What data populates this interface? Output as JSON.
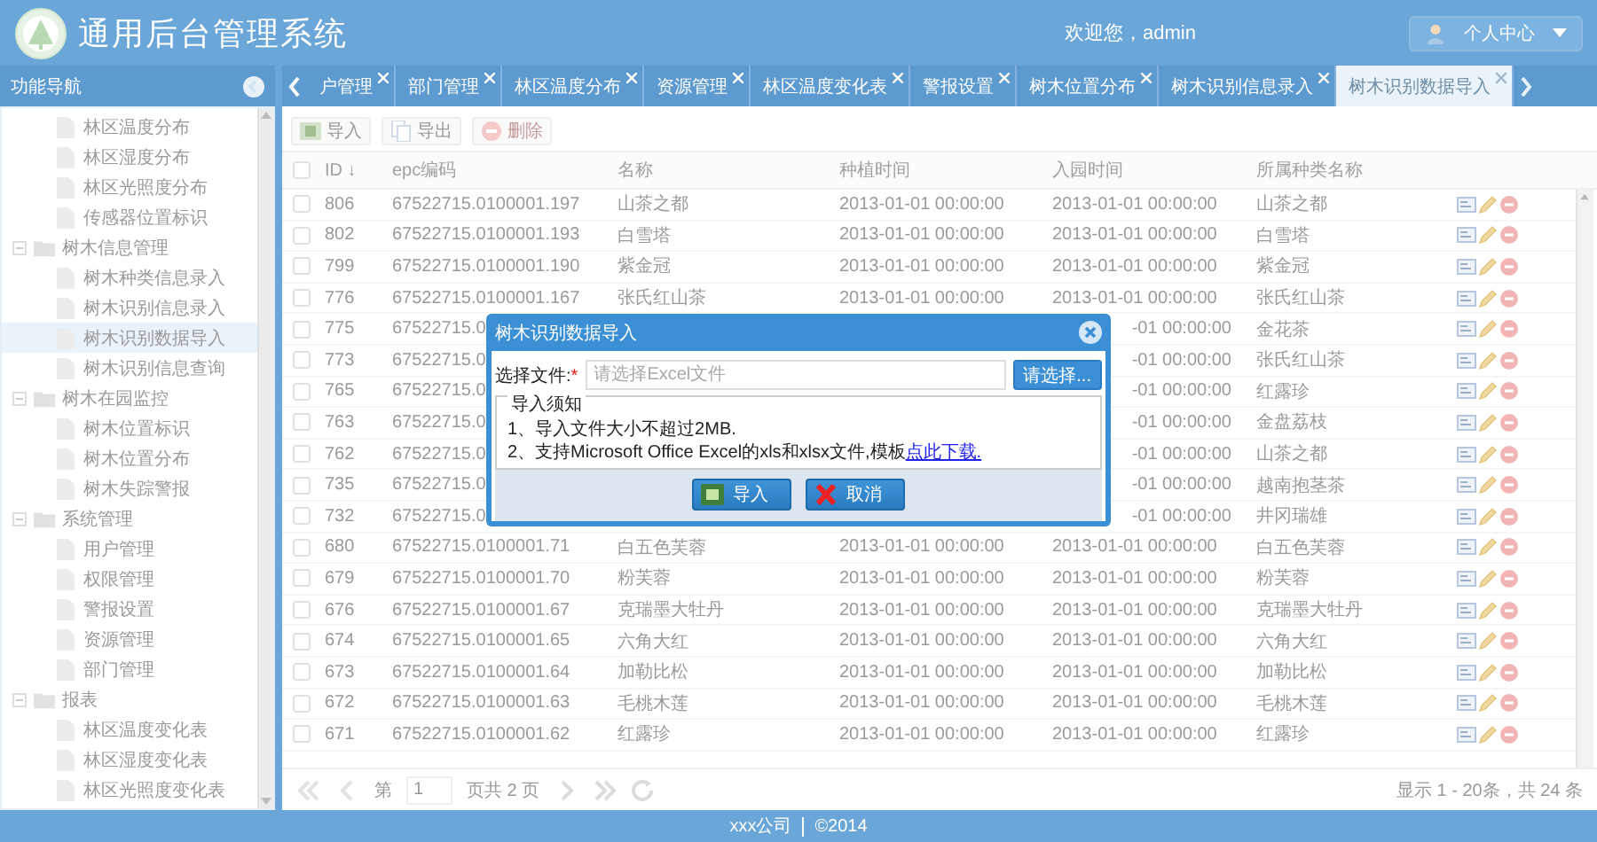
{
  "header": {
    "title": "通用后台管理系统",
    "welcome": "欢迎您，admin",
    "user_menu": "个人中心"
  },
  "sidebar": {
    "title": "功能导航",
    "tree": [
      {
        "children": [
          {
            "label": "林区温度分布",
            "selected": false
          },
          {
            "label": "林区湿度分布",
            "selected": false
          },
          {
            "label": "林区光照度分布",
            "selected": false
          },
          {
            "label": "传感器位置标识",
            "selected": false
          }
        ]
      },
      {
        "label": "树木信息管理",
        "expanded": true,
        "children": [
          {
            "label": "树木种类信息录入",
            "selected": false
          },
          {
            "label": "树木识别信息录入",
            "selected": false
          },
          {
            "label": "树木识别数据导入",
            "selected": true
          },
          {
            "label": "树木识别信息查询",
            "selected": false
          }
        ]
      },
      {
        "label": "树木在园监控",
        "expanded": true,
        "children": [
          {
            "label": "树木位置标识",
            "selected": false
          },
          {
            "label": "树木位置分布",
            "selected": false
          },
          {
            "label": "树木失踪警报",
            "selected": false
          }
        ]
      },
      {
        "label": "系统管理",
        "expanded": true,
        "children": [
          {
            "label": "用户管理",
            "selected": false
          },
          {
            "label": "权限管理",
            "selected": false
          },
          {
            "label": "警报设置",
            "selected": false
          },
          {
            "label": "资源管理",
            "selected": false
          },
          {
            "label": "部门管理",
            "selected": false
          }
        ]
      },
      {
        "label": "报表",
        "expanded": true,
        "children": [
          {
            "label": "林区温度变化表",
            "selected": false
          },
          {
            "label": "林区湿度变化表",
            "selected": false
          },
          {
            "label": "林区光照度变化表",
            "selected": false
          }
        ]
      }
    ]
  },
  "tabs": [
    {
      "label": "户管理",
      "selected": false
    },
    {
      "label": "部门管理",
      "selected": false
    },
    {
      "label": "林区温度分布",
      "selected": false
    },
    {
      "label": "资源管理",
      "selected": false
    },
    {
      "label": "林区温度变化表",
      "selected": false
    },
    {
      "label": "警报设置",
      "selected": false
    },
    {
      "label": "树木位置分布",
      "selected": false
    },
    {
      "label": "树木识别信息录入",
      "selected": false
    },
    {
      "label": "树木识别数据导入",
      "selected": true
    }
  ],
  "toolbar": [
    {
      "label": "导入",
      "kind": "import",
      "disabled": false
    },
    {
      "label": "导出",
      "kind": "export",
      "disabled": false
    },
    {
      "label": "删除",
      "kind": "delete",
      "disabled": true
    }
  ],
  "table": {
    "all_checked": false,
    "columns": [
      "ID ↓",
      "epc编码",
      "名称",
      "种植时间",
      "入园时间",
      "所属种类名称"
    ],
    "rows": [
      {
        "checked": false,
        "id": "806",
        "epc": "67522715.0100001.197",
        "name": "山茶之都",
        "planted": "2013-01-01 00:00:00",
        "entered": "2013-01-01 00:00:00",
        "species": "山茶之都"
      },
      {
        "checked": false,
        "id": "802",
        "epc": "67522715.0100001.193",
        "name": "白雪塔",
        "planted": "2013-01-01 00:00:00",
        "entered": "2013-01-01 00:00:00",
        "species": "白雪塔"
      },
      {
        "checked": false,
        "id": "799",
        "epc": "67522715.0100001.190",
        "name": "紫金冠",
        "planted": "2013-01-01 00:00:00",
        "entered": "2013-01-01 00:00:00",
        "species": "紫金冠"
      },
      {
        "checked": false,
        "id": "776",
        "epc": "67522715.0100001.167",
        "name": "张氏红山茶",
        "planted": "2013-01-01 00:00:00",
        "entered": "2013-01-01 00:00:00",
        "species": "张氏红山茶"
      },
      {
        "checked": false,
        "id": "775",
        "epc": "67522715.0",
        "entered": "-01 00:00:00",
        "species": "金花茶"
      },
      {
        "checked": false,
        "id": "773",
        "epc": "67522715.0",
        "entered": "-01 00:00:00",
        "species": "张氏红山茶"
      },
      {
        "checked": false,
        "id": "765",
        "epc": "67522715.0",
        "entered": "-01 00:00:00",
        "species": "红露珍"
      },
      {
        "checked": false,
        "id": "763",
        "epc": "67522715.0",
        "entered": "-01 00:00:00",
        "species": "金盘荔枝"
      },
      {
        "checked": false,
        "id": "762",
        "epc": "67522715.0",
        "entered": "-01 00:00:00",
        "species": "山茶之都"
      },
      {
        "checked": false,
        "id": "735",
        "epc": "67522715.0",
        "entered": "-01 00:00:00",
        "species": "越南抱茎茶"
      },
      {
        "checked": false,
        "id": "732",
        "epc": "67522715.0",
        "entered": "-01 00:00:00",
        "species": "井冈瑞雄"
      },
      {
        "checked": false,
        "id": "680",
        "epc": "67522715.0100001.71",
        "name": "白五色芙蓉",
        "planted": "2013-01-01 00:00:00",
        "entered": "2013-01-01 00:00:00",
        "species": "白五色芙蓉"
      },
      {
        "checked": false,
        "id": "679",
        "epc": "67522715.0100001.70",
        "name": "粉芙蓉",
        "planted": "2013-01-01 00:00:00",
        "entered": "2013-01-01 00:00:00",
        "species": "粉芙蓉"
      },
      {
        "checked": false,
        "id": "676",
        "epc": "67522715.0100001.67",
        "name": "克瑞墨大牡丹",
        "planted": "2013-01-01 00:00:00",
        "entered": "2013-01-01 00:00:00",
        "species": "克瑞墨大牡丹"
      },
      {
        "checked": false,
        "id": "674",
        "epc": "67522715.0100001.65",
        "name": "六角大红",
        "planted": "2013-01-01 00:00:00",
        "entered": "2013-01-01 00:00:00",
        "species": "六角大红"
      },
      {
        "checked": false,
        "id": "673",
        "epc": "67522715.0100001.64",
        "name": "加勒比松",
        "planted": "2013-01-01 00:00:00",
        "entered": "2013-01-01 00:00:00",
        "species": "加勒比松"
      },
      {
        "checked": false,
        "id": "672",
        "epc": "67522715.0100001.63",
        "name": "毛桃木莲",
        "planted": "2013-01-01 00:00:00",
        "entered": "2013-01-01 00:00:00",
        "species": "毛桃木莲"
      },
      {
        "checked": false,
        "id": "671",
        "epc": "67522715.0100001.62",
        "name": "红露珍",
        "planted": "2013-01-01 00:00:00",
        "entered": "2013-01-01 00:00:00",
        "species": "红露珍"
      }
    ]
  },
  "pager": {
    "page_prefix": "第",
    "page": "1",
    "page_suffix": "页共 2 页",
    "summary": "显示 1 - 20条，共 24 条"
  },
  "footer": {
    "company": "xxx公司",
    "copyright": "©2014"
  },
  "dialog": {
    "title": "树木识别数据导入",
    "file_label": "选择文件:",
    "required_mark": "*",
    "placeholder": "请选择Excel文件",
    "browse": "请选择...",
    "notice_title": "导入须知",
    "notes": [
      "1、导入文件大小不超过2MB.",
      "2、支持Microsoft Office Excel的xls和xlsx文件,模板"
    ],
    "link": "点此下载.",
    "buttons": [
      {
        "label": "导入",
        "kind": "ok"
      },
      {
        "label": "取消",
        "kind": "cancel"
      }
    ]
  }
}
